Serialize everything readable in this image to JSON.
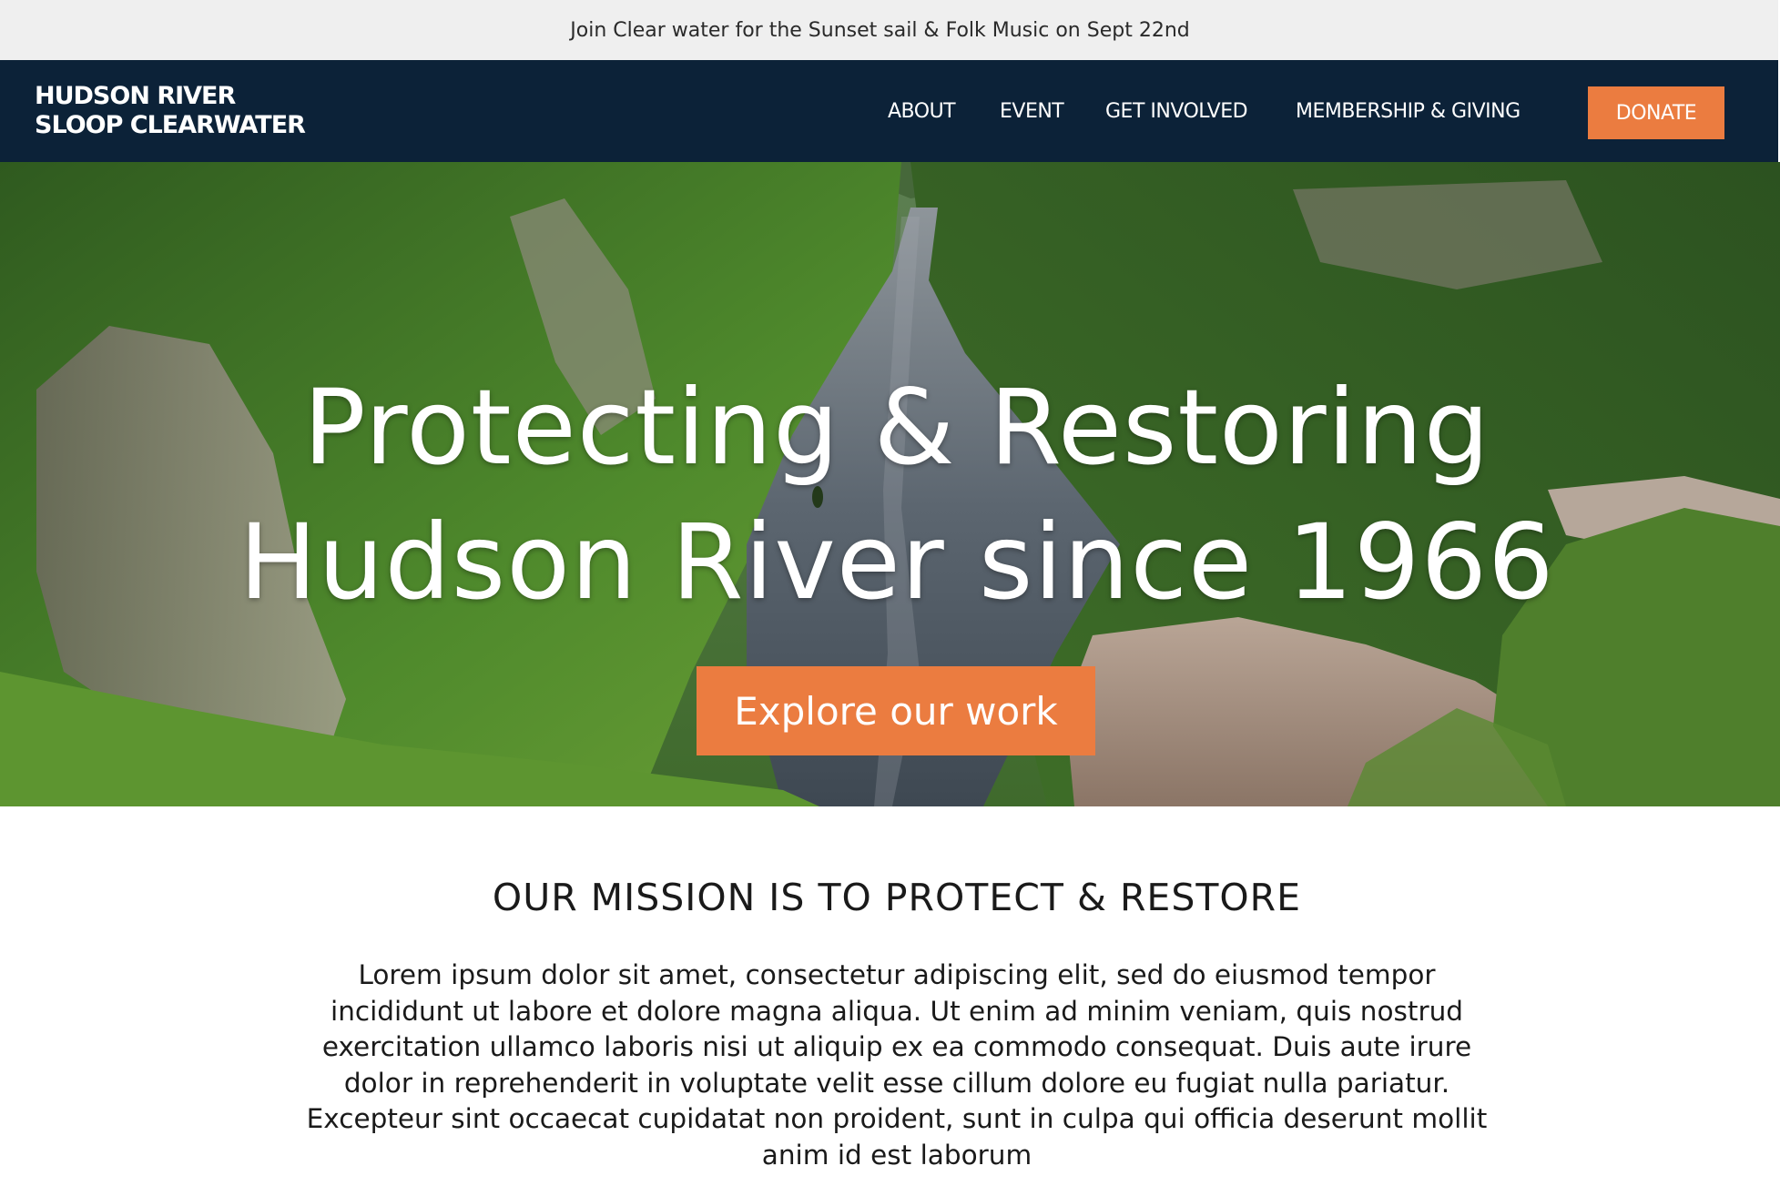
{
  "announcement": {
    "text": "Join Clear water for the Sunset sail & Folk Music on Sept 22nd"
  },
  "brand": {
    "line1": "HUDSON RIVER",
    "line2": "SLOOP CLEARWATER"
  },
  "nav": {
    "items": [
      {
        "label": "ABOUT"
      },
      {
        "label": "EVENT"
      },
      {
        "label": "GET INVOLVED"
      },
      {
        "label": "MEMBERSHIP & GIVING"
      }
    ],
    "donate_label": "DONATE"
  },
  "hero": {
    "title_line1": "Protecting & Restoring",
    "title_line2": "Hudson River since 1966",
    "cta_label": "Explore our work"
  },
  "mission": {
    "title": "OUR MISSION IS TO PROTECT & RESTORE",
    "body_lines": [
      "Lorem ipsum dolor sit amet, consectetur adipiscing elit, sed do eiusmod tempor",
      "incididunt ut labore et dolore magna aliqua. Ut enim ad minim veniam, quis nostrud",
      "exercitation ullamco laboris nisi ut aliquip ex ea commodo consequat. Duis aute irure",
      "dolor in reprehenderit in voluptate velit esse cillum dolore eu fugiat nulla pariatur.",
      "Excepteur sint occaecat cupidatat non proident, sunt in culpa qui officia deserunt mollit",
      "anim id est laborum"
    ]
  },
  "colors": {
    "announcement_bg": "#efefef",
    "navbar_bg": "#0c2238",
    "accent": "#eb7c40",
    "text_dark": "#1a1a1a"
  }
}
